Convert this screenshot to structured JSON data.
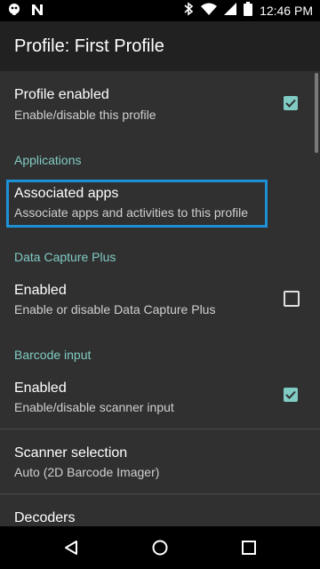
{
  "status_bar": {
    "time": "12:46 PM",
    "left_icons": [
      "notification-icon",
      "n-app-icon"
    ],
    "right_icons": [
      "bluetooth-icon",
      "wifi-icon",
      "signal-icon",
      "battery-icon"
    ]
  },
  "app_bar": {
    "title": "Profile: First Profile"
  },
  "settings": {
    "profile_enabled": {
      "title": "Profile enabled",
      "summary": "Enable/disable this profile",
      "checked": true
    },
    "applications_header": "Applications",
    "associated_apps": {
      "title": "Associated apps",
      "summary": "Associate apps and activities to this profile"
    },
    "dcp_header": "Data Capture Plus",
    "dcp_enabled": {
      "title": "Enabled",
      "summary": "Enable or disable Data Capture Plus",
      "checked": false
    },
    "barcode_header": "Barcode input",
    "barcode_enabled": {
      "title": "Enabled",
      "summary": "Enable/disable scanner input",
      "checked": true
    },
    "scanner_selection": {
      "title": "Scanner selection",
      "summary": "Auto (2D Barcode Imager)"
    },
    "decoders": {
      "title": "Decoders"
    }
  },
  "nav_bar": {
    "buttons": [
      "back-icon",
      "home-icon",
      "recents-icon"
    ]
  },
  "colors": {
    "accent": "#80cbc4",
    "highlight": "#1e90d6"
  }
}
